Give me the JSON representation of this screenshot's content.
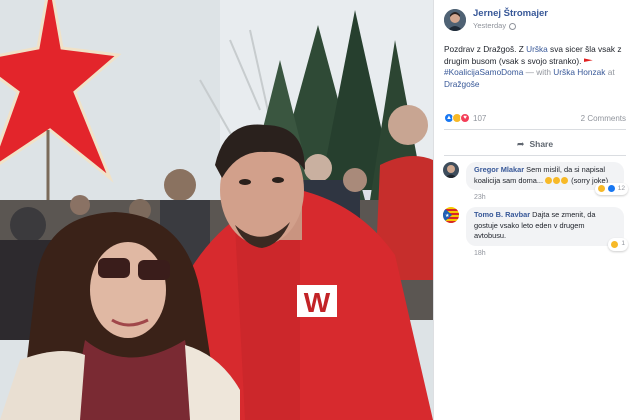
{
  "post": {
    "author": "Jernej Štromajer",
    "time": "Yesterday",
    "text_intro": "Pozdrav z Dražgoš. Z ",
    "mention1": "Urška",
    "text_mid": " sva sicer šla vsak z drugim busom (vsak s svojo stranko). ",
    "hashtag": "#KoalicijaSamoDoma",
    "with_text": " — with ",
    "mention2": "Urška Honzak",
    "at_text": " at ",
    "place": "Dražgoše",
    "reaction_count": "107",
    "comment_count": "2 Comments",
    "share_label": "Share"
  },
  "comments": [
    {
      "name": "Gregor Mlakar",
      "text": " Sem mislil, da si napisal koalicija sam doma... ",
      "suffix": " (sorry joke)",
      "reactions": "12",
      "time": "23h"
    },
    {
      "name": "Tomo B. Ravbar",
      "text": " Dajta se zmenit, da gostuje vsako leto eden v drugem avtobusu.",
      "reactions": "1",
      "time": "18h"
    }
  ],
  "photo": {
    "sweatshirt_letter": "W"
  },
  "colors": {
    "link": "#385898",
    "star_red": "#e3252b",
    "jacket_red": "#d72a2e"
  }
}
